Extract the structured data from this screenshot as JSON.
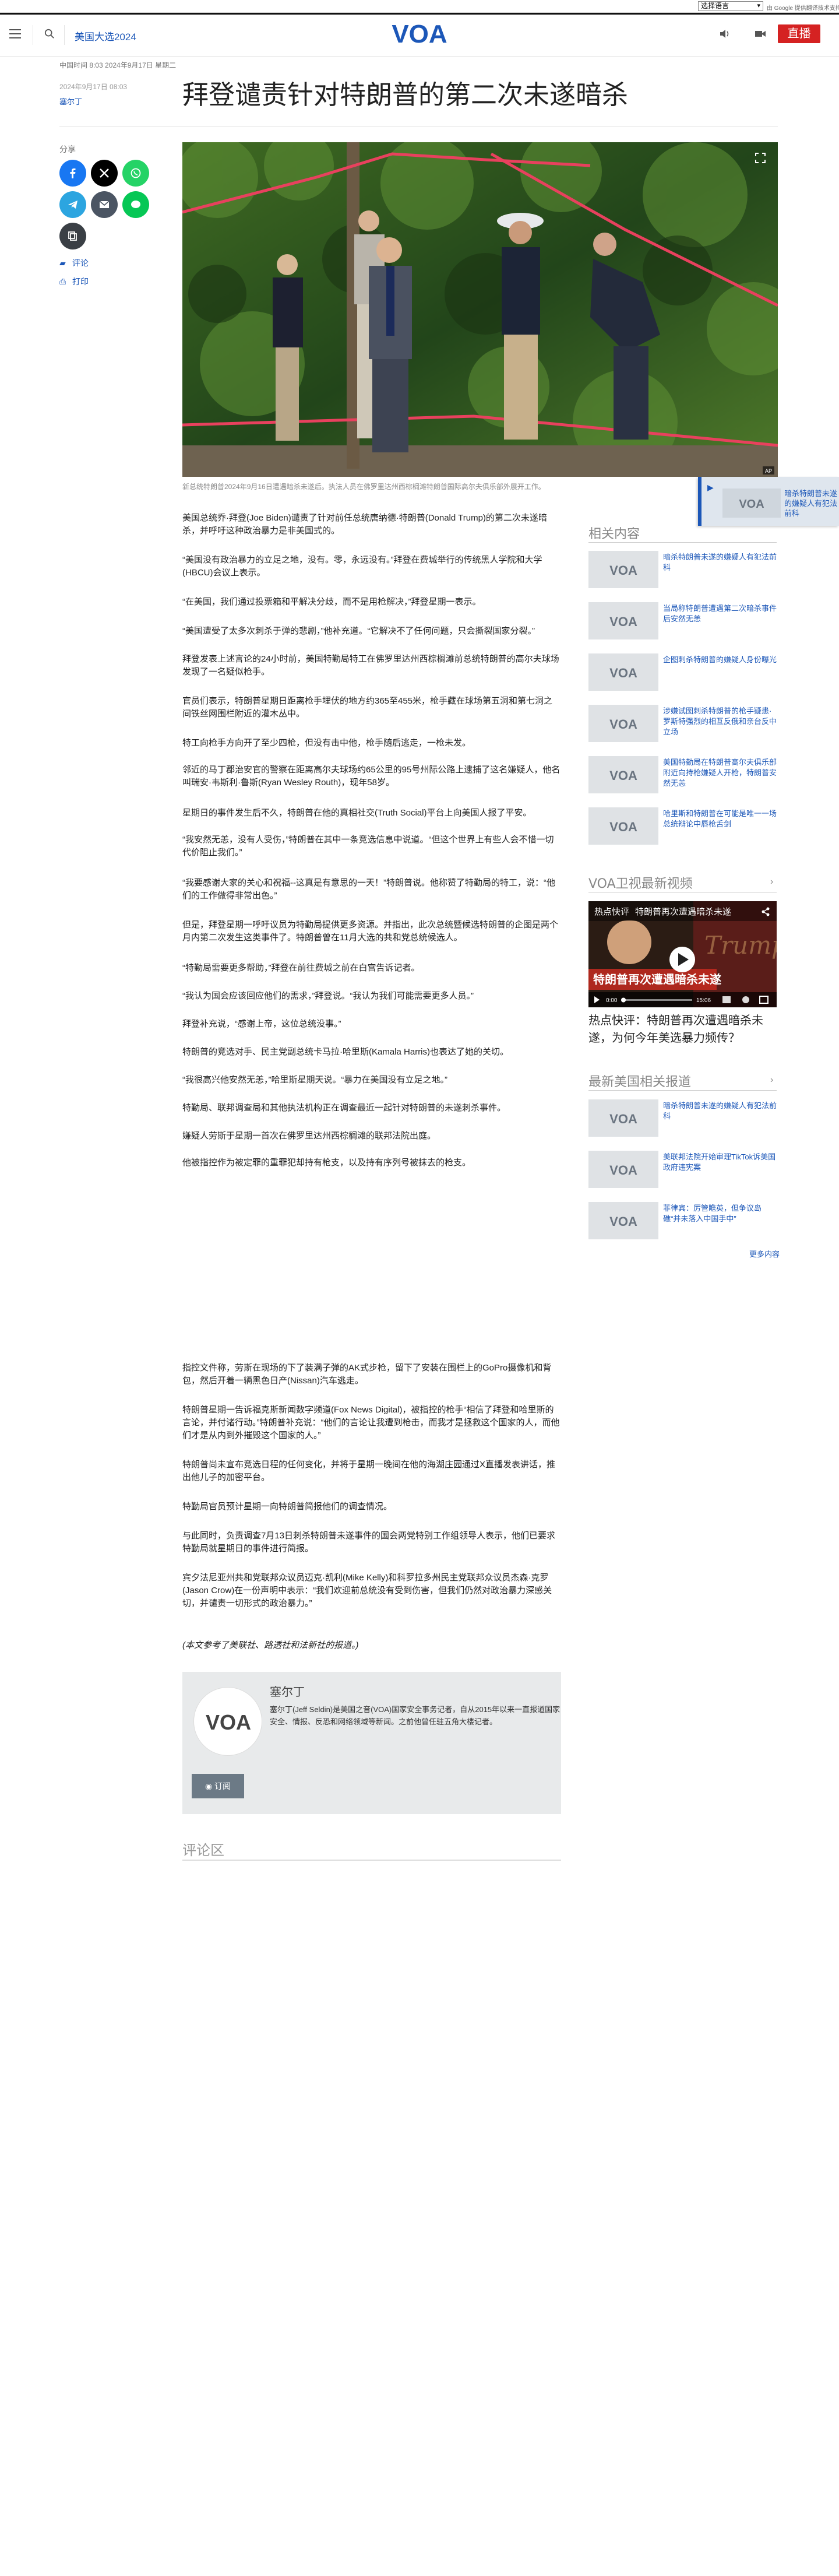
{
  "google_translate": {
    "select_value": "选择语言",
    "powered_by": "由 Google 提供翻译技术支持",
    "google_word": "Google"
  },
  "header": {
    "section_link": "美国大选2024",
    "logo_text": "VOA",
    "live_label": "直播"
  },
  "article": {
    "dateline": "中国时间 8:03 2024年9月17日 星期二",
    "date": "2024年9月17日 08:03",
    "author": "塞尔丁",
    "headline": "拜登谴责针对特朗普的第二次未遂暗杀",
    "caption": "新总统特朗普2024年9月16日遭遇暗杀未遂后。执法人员在佛罗里达州西棕榈滩特朗普国际高尔夫俱乐部外展开工作。",
    "paragraphs": [
      "美国总统乔·拜登(Joe Biden)谴责了针对前任总统唐纳德·特朗普(Donald Trump)的第二次未遂暗杀，并呼吁这种政治暴力是非美国式的。",
      "“美国没有政治暴力的立足之地，没有。零，永远没有。”拜登在费城举行的传统黑人学院和大学(HBCU)会议上表示。",
      "“在美国，我们通过投票箱和平解决分歧，而不是用枪解决，”拜登星期一表示。",
      "“美国遭受了太多次刺杀于弹的悲剧，”他补充道。“它解决不了任何问题，只会撕裂国家分裂。”",
      "拜登发表上述言论的24小时前，美国特勤局特工在佛罗里达州西棕榈滩前总统特朗普的高尔夫球场发现了一名疑似枪手。",
      "官员们表示，特朗普星期日距离枪手埋伏的地方约365至455米，枪手藏在球场第五洞和第七洞之间铁丝网围栏附近的灌木丛中。",
      "特工向枪手方向开了至少四枪，但没有击中他，枪手随后逃走，一枪未发。",
      "邻近的马丁郡治安官的警察在距离高尔夫球场约65公里的95号州际公路上逮捕了这名嫌疑人，他名叫瑞安·韦斯利·鲁斯(Ryan Wesley Routh)，现年58岁。",
      "星期日的事件发生后不久，特朗普在他的真相社交(Truth Social)平台上向美国人报了平安。",
      "“我安然无恙，没有人受伤，”特朗普在其中一条竞选信息中说道。“但这个世界上有些人会不惜一切代价阻止我们。”",
      "“我要感谢大家的关心和祝福--这真是有意思的一天！”特朗普说。他称赞了特勤局的特工，说：“他们的工作做得非常出色。”",
      "但是，拜登星期一呼吁议员为特勤局提供更多资源。并指出，此次总统暨候选特朗普的企图是两个月内第二次发生这类事件了。特朗普曾在11月大选的共和党总统候选人。",
      "“特勤局需要更多帮助，”拜登在前往费城之前在白宫告诉记者。",
      "“我认为国会应该回应他们的需求，”拜登说。“我认为我们可能需要更多人员。”",
      "拜登补充说，“感谢上帝，这位总统没事。”",
      "特朗普的竞选对手、民主党副总统卡马拉·哈里斯(Kamala Harris)也表达了她的关切。",
      "“我很高兴他安然无恙，”哈里斯星期天说。“暴力在美国没有立足之地。”",
      "特勤局、联邦调查局和其他执法机构正在调查最近一起针对特朗普的未遂刺杀事件。",
      "嫌疑人劳斯于星期一首次在佛罗里达州西棕榈滩的联邦法院出庭。",
      "他被指控作为被定罪的重罪犯却持有枪支，以及持有序列号被抹去的枪支。",
      "指控文件称，劳斯在现场的下了装满子弹的AK式步枪，留下了安装在围栏上的GoPro摄像机和背包，然后开着一辆黑色日产(Nissan)汽车逃走。",
      "特朗普星期一告诉福克斯新闻数字频道(Fox News Digital)，被指控的枪手“相信了拜登和哈里斯的言论，并付诸行动。”特朗普补充说：“他们的言论让我遭到枪击，而我才是拯救这个国家的人，而他们才是从内到外摧毁这个国家的人。”",
      "特朗普尚未宣布竞选日程的任何变化，并将于星期一晚间在他的海湖庄园通过X直播发表讲话，推出他儿子的加密平台。",
      "特勤局官员预计星期一向特朗普简报他们的调查情况。",
      "与此同时，负责调查7月13日刺杀特朗普未遂事件的国会两党特别工作组领导人表示，他们已要求特勤局就星期日的事件进行简报。",
      "宾夕法尼亚州共和党联邦众议员迈克·凯利(Mike Kelly)和科罗拉多州民主党联邦众议员杰森·克罗(Jason Crow)在一份声明中表示：“我们欢迎前总统没有受到伤害，但我们仍然对政治暴力深感关切，并谴责一切形式的政治暴力。”",
      "(本文参考了美联社、路透社和法新社的报道。)"
    ]
  },
  "share": {
    "label": "分享",
    "comment": "评论",
    "print": "打印"
  },
  "author_box": {
    "name": "塞尔丁",
    "bio": "塞尔丁(Jeff Seldin)是美国之音(VOA)国家安全事务记者，自从2015年以来一直报道国家安全、情报、反恐和网络领域等新闻。之前他曾任驻五角大楼记者。",
    "subscribe": "订阅"
  },
  "comments": {
    "title": "评论区"
  },
  "sidebar": {
    "related_title": "相关内容",
    "related": [
      "暗杀特朗普未遂的嫌疑人有犯法前科",
      "当局称特朗普遭遇第二次暗杀事件后安然无恙",
      "企图刺杀特朗普的嫌疑人身份曝光",
      "涉嫌试图刺杀特朗普的枪手疑患·罗斯特强烈的相互反俄和亲台反中立场",
      "美国特勤局在特朗普高尔夫俱乐部附近向持枪嫌疑人开枪，特朗普安然无恙",
      "哈里斯和特朗普在可能是唯一一场总统辩论中唇枪舌剑"
    ],
    "video_title": "VOA卫视最新视频",
    "video_caption": "热点快评：特朗普再次遭遇暗杀未遂，为何今年美选暴力频传？",
    "video_overlay_brand": "热点快评",
    "video_overlay_headline": "特朗普再次遭遇暗杀未遂",
    "video_time": "0:00",
    "video_duration": "15:06",
    "latest_title": "最新美国相关报道",
    "latest": [
      "暗杀特朗普未遂的嫌疑人有犯法前科",
      "美联邦法院开始审理TikTok诉美国政府违宪案",
      "菲律宾：厉管瞻英，但争议岛礁“并未落入中国手中”"
    ],
    "more": "更多内容"
  },
  "sticky": {
    "text": "暗杀特朗普未遂的嫌疑人有犯法前科"
  },
  "colors": {
    "brand_blue": "#1c57b8",
    "live_red": "#d52222",
    "facebook": "#1877f2",
    "twitter": "#000000",
    "whatsapp": "#25d366",
    "telegram": "#2ca5e0",
    "email": "#4b5563",
    "line": "#06c755",
    "copy": "#3a3f45"
  }
}
